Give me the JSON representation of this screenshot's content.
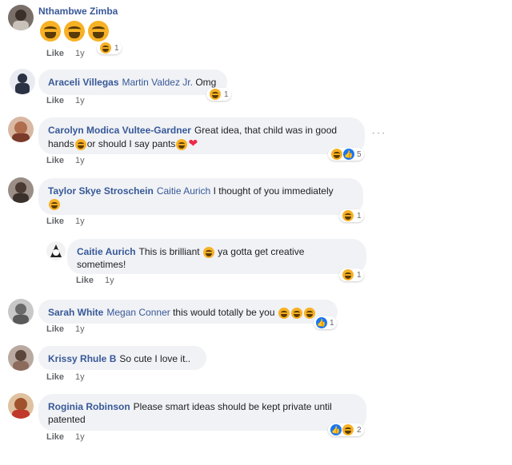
{
  "comments": [
    {
      "name": "Nthambwe Zimba",
      "tag": "",
      "text": "",
      "like": "Like",
      "time": "1y",
      "react_count": "1"
    },
    {
      "name": "Araceli Villegas",
      "tag": "Martin Valdez Jr.",
      "text": "Omg",
      "like": "Like",
      "time": "1y",
      "react_count": "1"
    },
    {
      "name": "Carolyn Modica Vultee-Gardner",
      "tag": "",
      "text1": "Great idea, that child was in good",
      "text2a": "hands",
      "text2b": "or should I say pants",
      "like": "Like",
      "time": "1y",
      "react_count": "5"
    },
    {
      "name": "Taylor Skye Stroschein",
      "tag": "Caitie Aurich",
      "text": "I thought of you immediately",
      "like": "Like",
      "time": "1y",
      "react_count": "1"
    },
    {
      "name": "Caitie Aurich",
      "tag": "",
      "text1": "This is brilliant",
      "text1b": "ya gotta get creative",
      "text2": "sometimes!",
      "like": "Like",
      "time": "1y",
      "react_count": "1"
    },
    {
      "name": "Sarah White",
      "tag": "Megan Conner",
      "text": "this would totally be you",
      "like": "Like",
      "time": "1y",
      "react_count": "1"
    },
    {
      "name": "Krissy Rhule B",
      "tag": "",
      "text": "So cute I love it..",
      "like": "Like",
      "time": "1y"
    },
    {
      "name": "Roginia Robinson",
      "tag": "",
      "text1": "Please smart ideas should be kept private until",
      "text2": "patented",
      "like": "Like",
      "time": "1y",
      "react_count": "2"
    }
  ],
  "icons": {
    "laugh": "laughing-tears-emoji",
    "like": "like-icon",
    "heart": "heart-emoji",
    "more": "more-options-icon"
  },
  "colors": {
    "name": "#385898",
    "bubble": "#f0f2f5",
    "meta": "#65676b",
    "like_blue": "#1877f2",
    "heart": "#f02849",
    "emoji": "#f7b125"
  }
}
